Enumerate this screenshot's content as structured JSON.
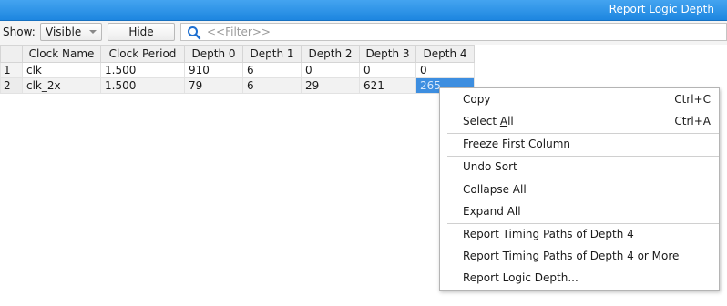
{
  "window": {
    "title": "Report Logic Depth"
  },
  "toolbar": {
    "show_label": "Show:",
    "show_value": "Visible",
    "hide_label": "Hide",
    "filter_placeholder": "<<Filter>>"
  },
  "table": {
    "columns": [
      "Clock Name",
      "Clock Period",
      "Depth 0",
      "Depth 1",
      "Depth 2",
      "Depth 3",
      "Depth 4"
    ],
    "rows": [
      {
        "num": "1",
        "cells": [
          "clk",
          "1.500",
          "910",
          "6",
          "0",
          "0",
          "0"
        ]
      },
      {
        "num": "2",
        "cells": [
          "clk_2x",
          "1.500",
          "79",
          "6",
          "29",
          "621",
          "265"
        ]
      }
    ]
  },
  "context_menu": {
    "items": [
      {
        "label": "Copy",
        "shortcut": "Ctrl+C"
      },
      {
        "label_pre": "Select ",
        "label_ul": "A",
        "label_post": "ll",
        "shortcut": "Ctrl+A"
      },
      {
        "label": "Freeze First Column"
      },
      {
        "label": "Undo Sort"
      },
      {
        "label": "Collapse All"
      },
      {
        "label": "Expand All"
      },
      {
        "label": "Report Timing Paths of Depth 4"
      },
      {
        "label": "Report Timing Paths of Depth 4 or More"
      },
      {
        "label": "Report Logic Depth..."
      }
    ]
  },
  "colors": {
    "titlebar": "#1d86e0",
    "selection": "#3d8ee0"
  }
}
